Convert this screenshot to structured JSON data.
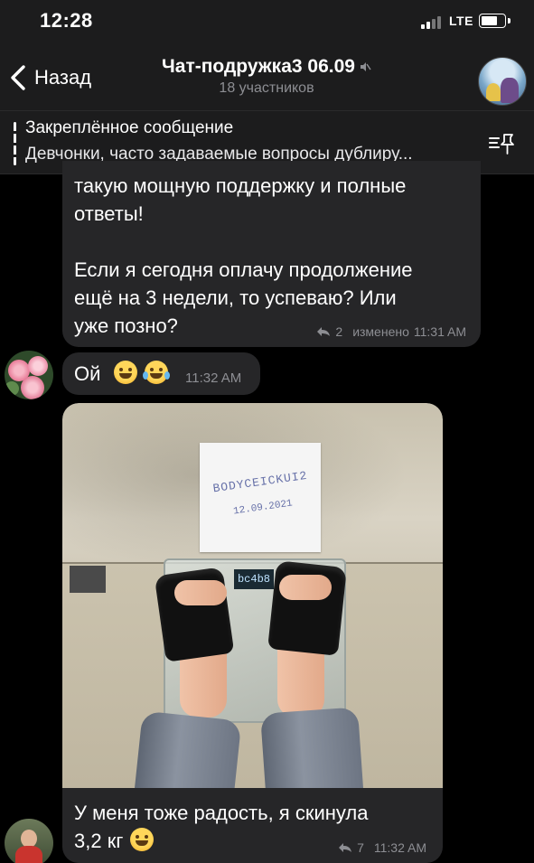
{
  "status_bar": {
    "time": "12:28",
    "network": "LTE"
  },
  "header": {
    "back_label": "Назад",
    "chat_title": "Чат-подружка3 06.09",
    "participants": "18 участников"
  },
  "pinned": {
    "title": "Закреплённое сообщение",
    "text": "Девчонки, часто задаваемые вопросы дублиру..."
  },
  "messages": [
    {
      "text_lines": [
        "такую мощную поддержку и полные",
        "ответы!",
        "",
        "Если я сегодня оплачу продолжение",
        "ещё на 3 недели, то успеваю? Или",
        "уже позно?"
      ],
      "replies": "2",
      "edited_label": "изменено",
      "time": "11:31 AM"
    },
    {
      "text": "Ой",
      "emojis": [
        "grinning-face-icon",
        "tears-of-joy-icon"
      ],
      "time": "11:32 AM"
    },
    {
      "photo_note_line1": "BODYCEICKUI2",
      "photo_note_line2": "12.09.2021",
      "scale_reading": "bc4b8",
      "text_line1": "У меня тоже радость, я скинула",
      "text_line2": "3,2 кг",
      "emoji": "smiling-face-icon",
      "replies": "7",
      "time": "11:32 AM"
    }
  ],
  "colors": {
    "background": "#000000",
    "bar": "#1c1c1d",
    "bubble": "#262628",
    "secondary_text": "#8d8e93"
  }
}
